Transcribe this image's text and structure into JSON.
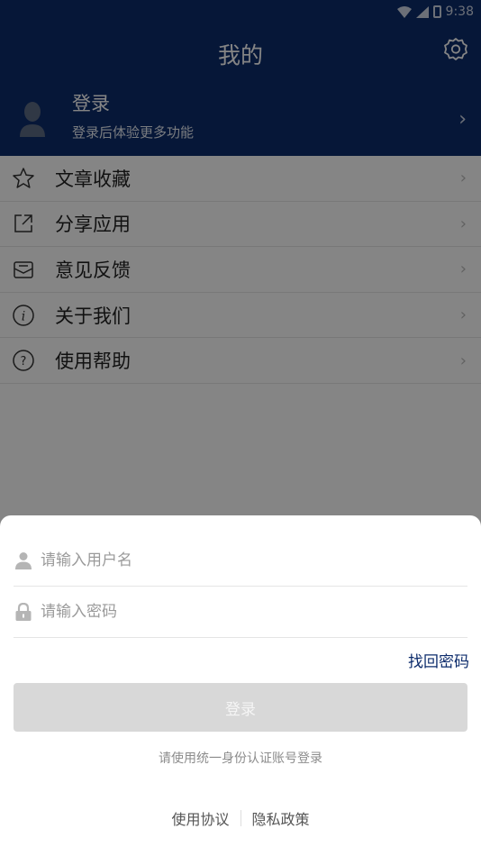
{
  "status_bar": {
    "time": "9:38"
  },
  "header": {
    "title": "我的",
    "settings_icon": "gear-icon",
    "profile": {
      "name": "登录",
      "subtitle": "登录后体验更多功能",
      "chevron": "›"
    }
  },
  "menu": {
    "items": [
      {
        "label": "文章收藏",
        "icon": "star-icon"
      },
      {
        "label": "分享应用",
        "icon": "share-icon"
      },
      {
        "label": "意见反馈",
        "icon": "feedback-icon"
      },
      {
        "label": "关于我们",
        "icon": "info-icon"
      },
      {
        "label": "使用帮助",
        "icon": "help-icon"
      }
    ],
    "chevron": "›"
  },
  "login_sheet": {
    "username_placeholder": "请输入用户名",
    "password_placeholder": "请输入密码",
    "forgot_password": "找回密码",
    "login_button": "登录",
    "hint": "请使用统一身份认证账号登录",
    "links": {
      "terms": "使用协议",
      "privacy": "隐私政策"
    }
  },
  "colors": {
    "primary": "#0d2c6c",
    "overlay": "rgba(0,0,0,0.48)",
    "button_disabled": "#d8d8d8"
  }
}
